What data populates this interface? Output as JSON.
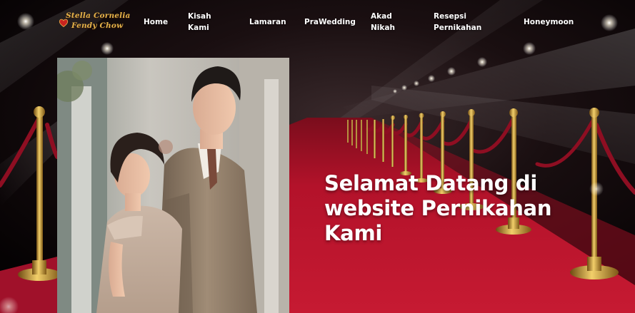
{
  "brand": {
    "line1": "Stella Cornelia",
    "line2": "Fendy Chow",
    "icon": "heart-ring-icon"
  },
  "nav": {
    "home": [
      "Home"
    ],
    "kisah": [
      "Kisah",
      "Kami"
    ],
    "lamaran": [
      "Lamaran"
    ],
    "prawedding": [
      "PraWedding"
    ],
    "akad": [
      "Akad",
      "Nikah"
    ],
    "resepsi": [
      "Resepsi",
      "Pernikahan"
    ],
    "honeymoon": [
      "Honeymoon"
    ]
  },
  "hero": {
    "lines": [
      "Selamat Datang di",
      "website Pernikahan",
      "Kami"
    ]
  },
  "colors": {
    "carpet": "#b3122a",
    "rope": "#8e0e22",
    "brass": "#c9a23a",
    "brand_gold": "#e3b24a",
    "nav_text": "#ffffff"
  }
}
